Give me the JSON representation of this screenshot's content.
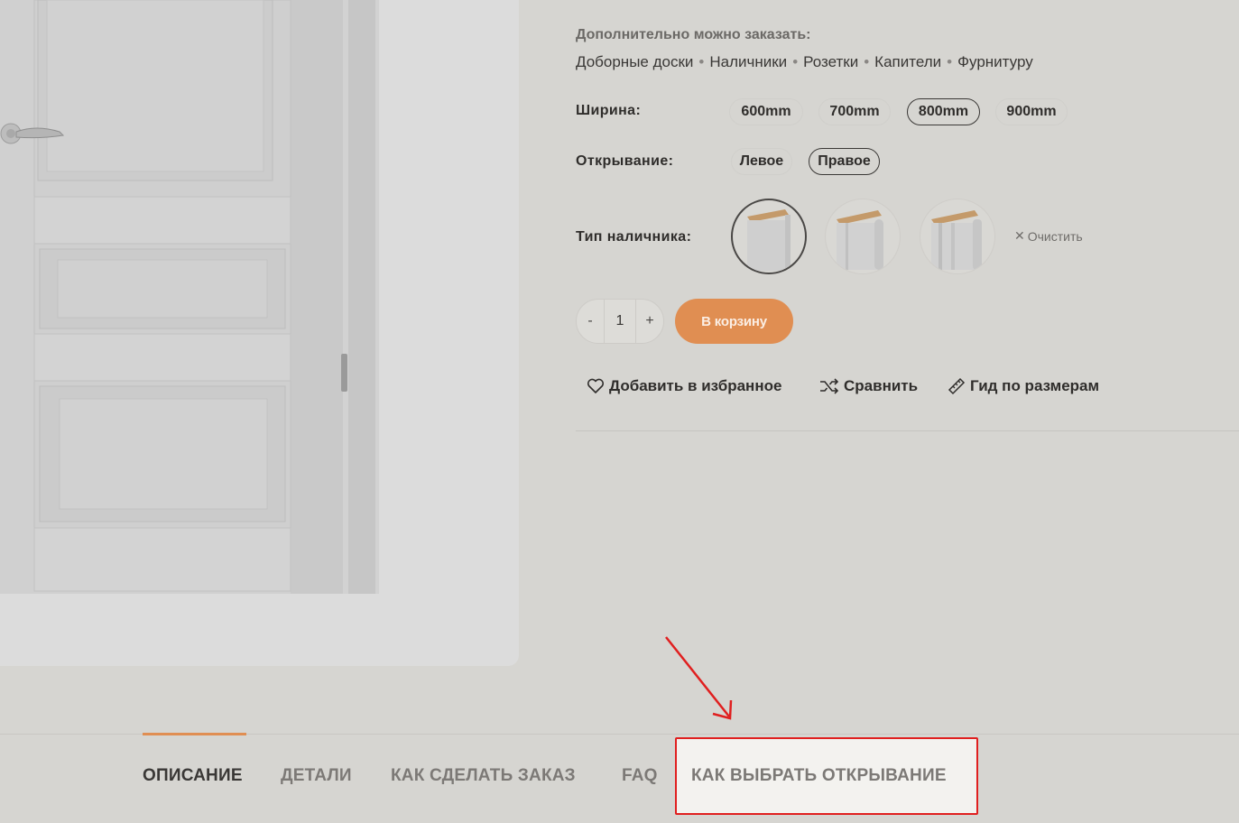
{
  "extras": {
    "title": "Дополнительно можно заказать:",
    "items": [
      "Доборные доски",
      "Наличники",
      "Розетки",
      "Капители",
      "Фурнитуру"
    ],
    "separator": "•"
  },
  "width": {
    "label": "Ширина:",
    "options": [
      "600mm",
      "700mm",
      "800mm",
      "900mm"
    ],
    "selected": "800mm"
  },
  "opening": {
    "label": "Открывание:",
    "options": [
      "Левое",
      "Правое"
    ],
    "selected": "Правое"
  },
  "casing": {
    "label": "Тип наличника:",
    "clear_label": "Очистить",
    "swatch_icons": [
      "flat-casing-icon",
      "rounded-casing-icon",
      "profiled-casing-icon"
    ]
  },
  "cart": {
    "minus": "-",
    "quantity": "1",
    "plus": "+",
    "button_label": "В корзину"
  },
  "actions": {
    "wishlist": "Добавить в избранное",
    "compare": "Сравнить",
    "size_guide": "Гид по размерам"
  },
  "tabs": [
    "ОПИСАНИЕ",
    "ДЕТАЛИ",
    "КАК СДЕЛАТЬ ЗАКАЗ",
    "FAQ",
    "КАК ВЫБРАТЬ ОТКРЫВАНИЕ"
  ],
  "colors": {
    "accent": "#e08e52",
    "highlight": "#e01f1f",
    "background": "#d6d5d1"
  }
}
